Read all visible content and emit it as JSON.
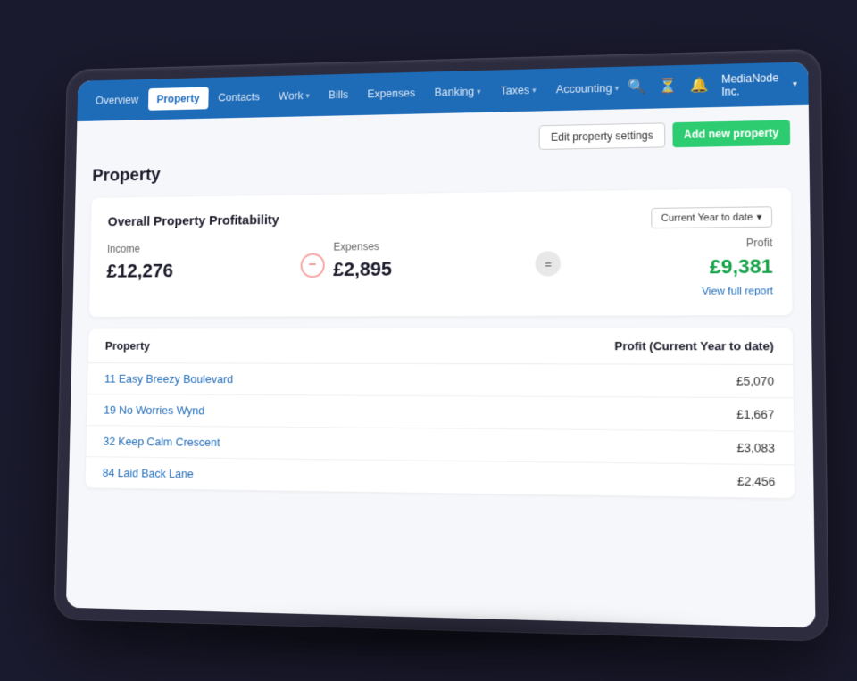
{
  "navbar": {
    "items": [
      {
        "id": "overview",
        "label": "Overview",
        "active": false,
        "hasDropdown": false
      },
      {
        "id": "property",
        "label": "Property",
        "active": true,
        "hasDropdown": false
      },
      {
        "id": "contacts",
        "label": "Contacts",
        "active": false,
        "hasDropdown": false
      },
      {
        "id": "work",
        "label": "Work",
        "active": false,
        "hasDropdown": true
      },
      {
        "id": "bills",
        "label": "Bills",
        "active": false,
        "hasDropdown": false
      },
      {
        "id": "expenses",
        "label": "Expenses",
        "active": false,
        "hasDropdown": false
      },
      {
        "id": "banking",
        "label": "Banking",
        "active": false,
        "hasDropdown": true
      },
      {
        "id": "taxes",
        "label": "Taxes",
        "active": false,
        "hasDropdown": true
      },
      {
        "id": "accounting",
        "label": "Accounting",
        "active": false,
        "hasDropdown": true
      }
    ],
    "user": "MediaNode Inc.",
    "search_icon": "🔍",
    "clock_icon": "⏱",
    "bell_icon": "🔔"
  },
  "actions": {
    "edit_label": "Edit property settings",
    "add_label": "Add new property"
  },
  "page": {
    "title": "Property"
  },
  "date_filter": {
    "label": "Current Year to date"
  },
  "profitability": {
    "section_title": "Overall Property Profitability",
    "income_label": "Income",
    "income_value": "£12,276",
    "expenses_label": "Expenses",
    "expenses_value": "£2,895",
    "profit_label": "Profit",
    "profit_value": "£9,381",
    "operator_minus": "−",
    "operator_equals": "=",
    "view_report": "View full report"
  },
  "property_table": {
    "col1_header": "Property",
    "col2_header": "Profit (Current Year to date)",
    "rows": [
      {
        "name": "11 Easy Breezy Boulevard",
        "amount": "£5,070"
      },
      {
        "name": "19 No Worries Wynd",
        "amount": "£1,667"
      },
      {
        "name": "32 Keep Calm Crescent",
        "amount": "£3,083"
      },
      {
        "name": "84 Laid Back Lane",
        "amount": "£2,456"
      }
    ]
  }
}
